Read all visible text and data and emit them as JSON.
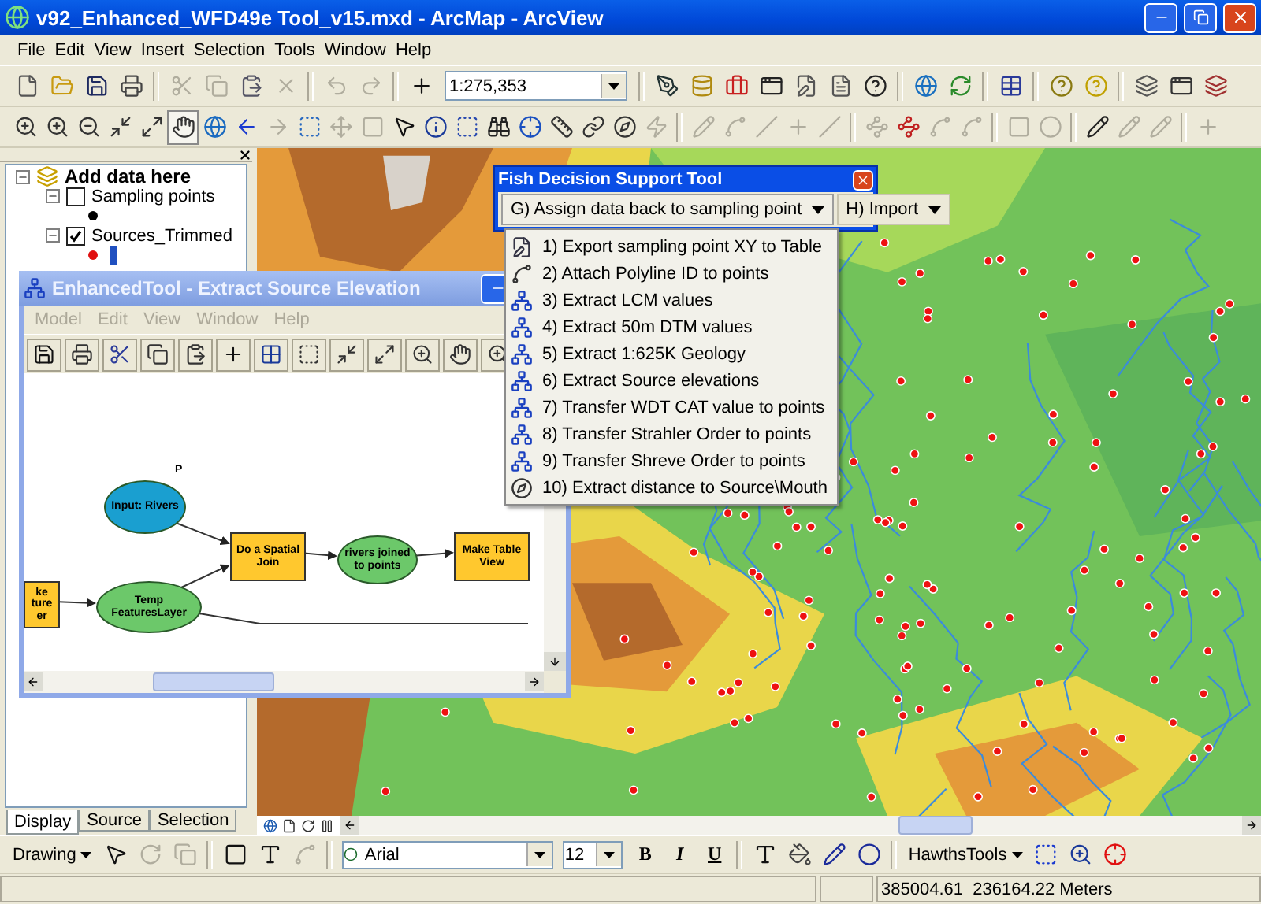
{
  "window": {
    "title": "v92_Enhanced_WFD49e Tool_v15.mxd - ArcMap - ArcView"
  },
  "menu_bar": [
    "File",
    "Edit",
    "View",
    "Insert",
    "Selection",
    "Tools",
    "Window",
    "Help"
  ],
  "standard_toolbar": {
    "buttons_left": [
      {
        "disabled": false
      },
      {
        "disabled": false
      },
      {
        "disabled": false
      },
      {
        "disabled": false
      },
      {
        "disabled": true
      },
      {
        "disabled": true
      },
      {
        "disabled": false
      },
      {
        "disabled": true
      },
      {
        "disabled": true
      },
      {
        "disabled": true
      },
      {
        "disabled": false
      }
    ],
    "scale": "1:275,353",
    "buttons_right": [
      {
        "disabled": false
      },
      {
        "disabled": false
      },
      {
        "disabled": false
      },
      {
        "disabled": false
      },
      {
        "disabled": false
      },
      {
        "disabled": false
      },
      {
        "disabled": false
      },
      {
        "disabled": false
      },
      {
        "disabled": false
      },
      {
        "disabled": false
      },
      {
        "disabled": false
      },
      {
        "disabled": false
      },
      {
        "disabled": false
      },
      {
        "disabled": false
      },
      {
        "disabled": false
      }
    ]
  },
  "tools_toolbar": [
    {
      "disabled": false,
      "selected": false
    },
    {
      "disabled": false,
      "selected": false
    },
    {
      "disabled": false,
      "selected": false
    },
    {
      "disabled": false,
      "selected": false
    },
    {
      "disabled": false,
      "selected": false
    },
    {
      "disabled": false,
      "selected": true
    },
    {
      "disabled": false,
      "selected": false
    },
    {
      "disabled": false,
      "selected": false
    },
    {
      "disabled": true,
      "selected": false
    },
    {
      "disabled": false,
      "selected": false
    },
    {
      "disabled": true,
      "selected": false
    },
    {
      "disabled": true,
      "selected": false
    },
    {
      "disabled": false,
      "selected": false
    },
    {
      "disabled": false,
      "selected": false
    },
    {
      "disabled": false,
      "selected": false
    },
    {
      "disabled": false,
      "selected": false
    },
    {
      "disabled": false,
      "selected": false
    },
    {
      "disabled": false,
      "selected": false
    },
    {
      "disabled": false,
      "selected": false
    },
    {
      "disabled": false,
      "selected": false
    },
    {
      "disabled": true,
      "selected": false
    },
    {
      "disabled": true,
      "selected": false
    },
    {
      "disabled": true,
      "selected": false
    },
    {
      "disabled": true,
      "selected": false
    },
    {
      "disabled": true,
      "selected": false
    },
    {
      "disabled": true,
      "selected": false
    },
    {
      "disabled": true,
      "selected": false
    },
    {
      "disabled": false,
      "selected": false
    },
    {
      "disabled": true,
      "selected": false
    },
    {
      "disabled": true,
      "selected": false
    },
    {
      "disabled": true,
      "selected": false
    },
    {
      "disabled": true,
      "selected": false
    },
    {
      "disabled": false,
      "selected": false
    },
    {
      "disabled": true,
      "selected": false
    },
    {
      "disabled": true,
      "selected": false
    },
    {
      "disabled": true,
      "selected": false
    }
  ],
  "table_of_contents": {
    "group": {
      "name": "Add data here",
      "expanded": true
    },
    "layers": [
      {
        "name": "Sampling points",
        "checked": false,
        "expanded": true,
        "symbols": [
          {
            "kind": "point",
            "color": "#000000"
          }
        ]
      },
      {
        "name": "Sources_Trimmed",
        "checked": true,
        "expanded": true,
        "symbols": [
          {
            "kind": "point",
            "color": "#e01010"
          },
          {
            "kind": "line",
            "color": "#2050c0"
          }
        ]
      }
    ],
    "tabs": [
      {
        "label": "Display",
        "selected": true
      },
      {
        "label": "Source",
        "selected": false
      },
      {
        "label": "Selection",
        "selected": false
      }
    ]
  },
  "fish_tool": {
    "title": "Fish Decision Support Tool",
    "menus": [
      {
        "label": "G) Assign data back to sampling point",
        "expanded": true
      },
      {
        "label": "H) Import",
        "expanded": false
      }
    ],
    "items": [
      {
        "label": "1) Export sampling point XY to Table",
        "kind": "notepad"
      },
      {
        "label": "2) Attach Polyline ID to points",
        "kind": "polyline"
      },
      {
        "label": "3) Extract LCM values",
        "kind": "model"
      },
      {
        "label": "4) Extract 50m DTM values",
        "kind": "model"
      },
      {
        "label": "5) Extract 1:625K Geology",
        "kind": "model"
      },
      {
        "label": "6) Extract Source elevations",
        "kind": "model"
      },
      {
        "label": "7) Transfer WDT CAT value to points",
        "kind": "model"
      },
      {
        "label": "8) Transfer Strahler Order to points",
        "kind": "model"
      },
      {
        "label": "9) Transfer Shreve Order to points",
        "kind": "model"
      },
      {
        "label": "10) Extract distance to Source\\Mouth",
        "kind": "measure"
      }
    ]
  },
  "model_window": {
    "title": "EnhancedTool - Extract Source Elevation",
    "menu": [
      {
        "label": "Model",
        "disabled": true
      },
      {
        "label": "Edit",
        "disabled": true
      },
      {
        "label": "View",
        "disabled": true
      },
      {
        "label": "Window",
        "disabled": true
      },
      {
        "label": "Help",
        "disabled": true
      }
    ],
    "marker": "P",
    "nodes": [
      {
        "label": "ke ture er",
        "kind": "tool"
      },
      {
        "label": "Input: Rivers",
        "kind": "input"
      },
      {
        "label": "Temp FeaturesLayer",
        "kind": "derived"
      },
      {
        "label": "Do a Spatial Join",
        "kind": "tool"
      },
      {
        "label": "rivers joined to points",
        "kind": "derived"
      },
      {
        "label": "Make Table View",
        "kind": "tool"
      }
    ]
  },
  "drawing_toolbar": {
    "drawing_menu": "Drawing",
    "font": "Arial",
    "font_size": "12",
    "bold": "B",
    "italic": "I",
    "underline": "U",
    "hawths_menu": "HawthsTools"
  },
  "status_bar": {
    "coordinates": "385004.61  236164.22 Meters"
  }
}
